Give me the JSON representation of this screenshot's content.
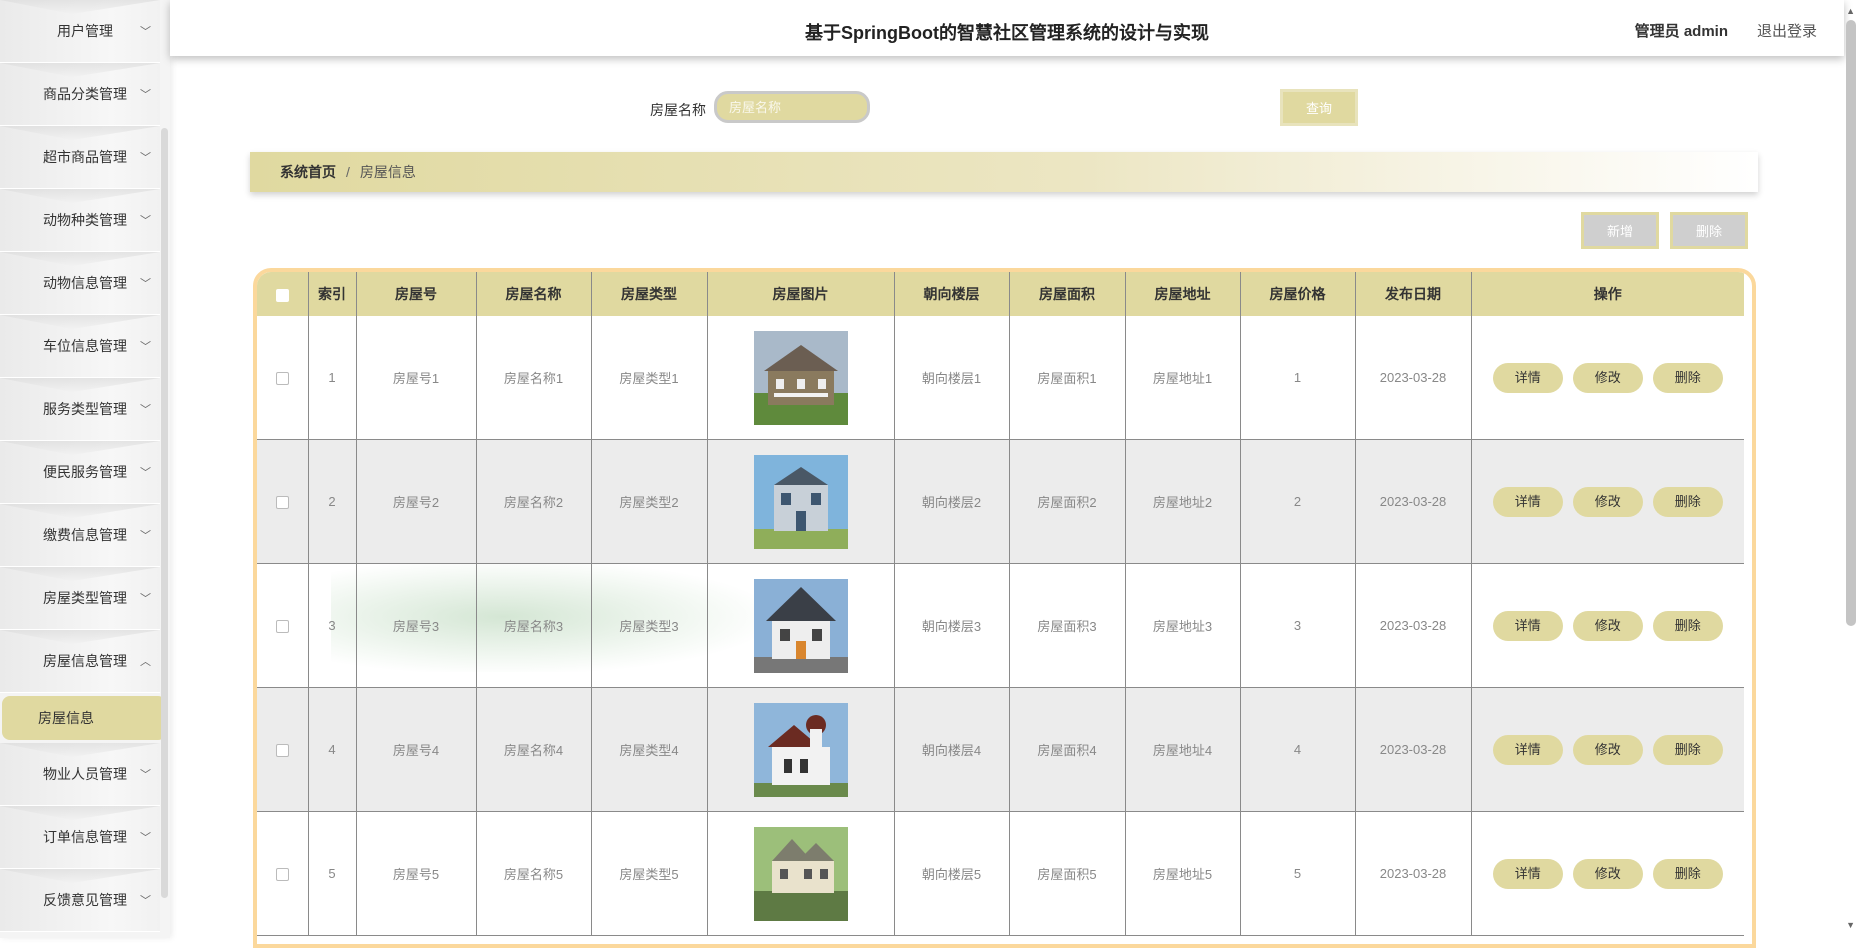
{
  "app": {
    "title": "基于SpringBoot的智慧社区管理系统的设计与实现"
  },
  "header": {
    "user_label": "管理员 admin",
    "logout_label": "退出登录"
  },
  "sidebar": {
    "items": [
      {
        "label": "用户管理"
      },
      {
        "label": "商品分类管理"
      },
      {
        "label": "超市商品管理"
      },
      {
        "label": "动物种类管理"
      },
      {
        "label": "动物信息管理"
      },
      {
        "label": "车位信息管理"
      },
      {
        "label": "服务类型管理"
      },
      {
        "label": "便民服务管理"
      },
      {
        "label": "缴费信息管理"
      },
      {
        "label": "房屋类型管理"
      },
      {
        "label": "房屋信息管理",
        "expanded": true
      },
      {
        "label": "物业人员管理"
      },
      {
        "label": "订单信息管理"
      },
      {
        "label": "反馈意见管理"
      }
    ],
    "active_sub": {
      "label": "房屋信息"
    }
  },
  "search": {
    "label": "房屋名称",
    "placeholder": "房屋名称",
    "button": "查询"
  },
  "breadcrumb": {
    "home": "系统首页",
    "separator": "/",
    "current": "房屋信息"
  },
  "actions": {
    "add": "新增",
    "delete": "删除"
  },
  "table": {
    "columns": [
      "",
      "索引",
      "房屋号",
      "房屋名称",
      "房屋类型",
      "房屋图片",
      "朝向楼层",
      "房屋面积",
      "房屋地址",
      "房屋价格",
      "发布日期",
      "操作"
    ],
    "op_labels": {
      "detail": "详情",
      "edit": "修改",
      "delete": "删除"
    },
    "rows": [
      {
        "index": "1",
        "no": "房屋号1",
        "name": "房屋名称1",
        "type": "房屋类型1",
        "floor": "朝向楼层1",
        "area": "房屋面积1",
        "address": "房屋地址1",
        "price": "1",
        "date": "2023-03-28"
      },
      {
        "index": "2",
        "no": "房屋号2",
        "name": "房屋名称2",
        "type": "房屋类型2",
        "floor": "朝向楼层2",
        "area": "房屋面积2",
        "address": "房屋地址2",
        "price": "2",
        "date": "2023-03-28"
      },
      {
        "index": "3",
        "no": "房屋号3",
        "name": "房屋名称3",
        "type": "房屋类型3",
        "floor": "朝向楼层3",
        "area": "房屋面积3",
        "address": "房屋地址3",
        "price": "3",
        "date": "2023-03-28"
      },
      {
        "index": "4",
        "no": "房屋号4",
        "name": "房屋名称4",
        "type": "房屋类型4",
        "floor": "朝向楼层4",
        "area": "房屋面积4",
        "address": "房屋地址4",
        "price": "4",
        "date": "2023-03-28"
      },
      {
        "index": "5",
        "no": "房屋号5",
        "name": "房屋名称5",
        "type": "房屋类型5",
        "floor": "朝向楼层5",
        "area": "房屋面积5",
        "address": "房屋地址5",
        "price": "5",
        "date": "2023-03-28"
      }
    ]
  },
  "colors": {
    "accent": "#e0d9a0",
    "table_border": "#fbd89c",
    "row_alt": "#ececec"
  }
}
